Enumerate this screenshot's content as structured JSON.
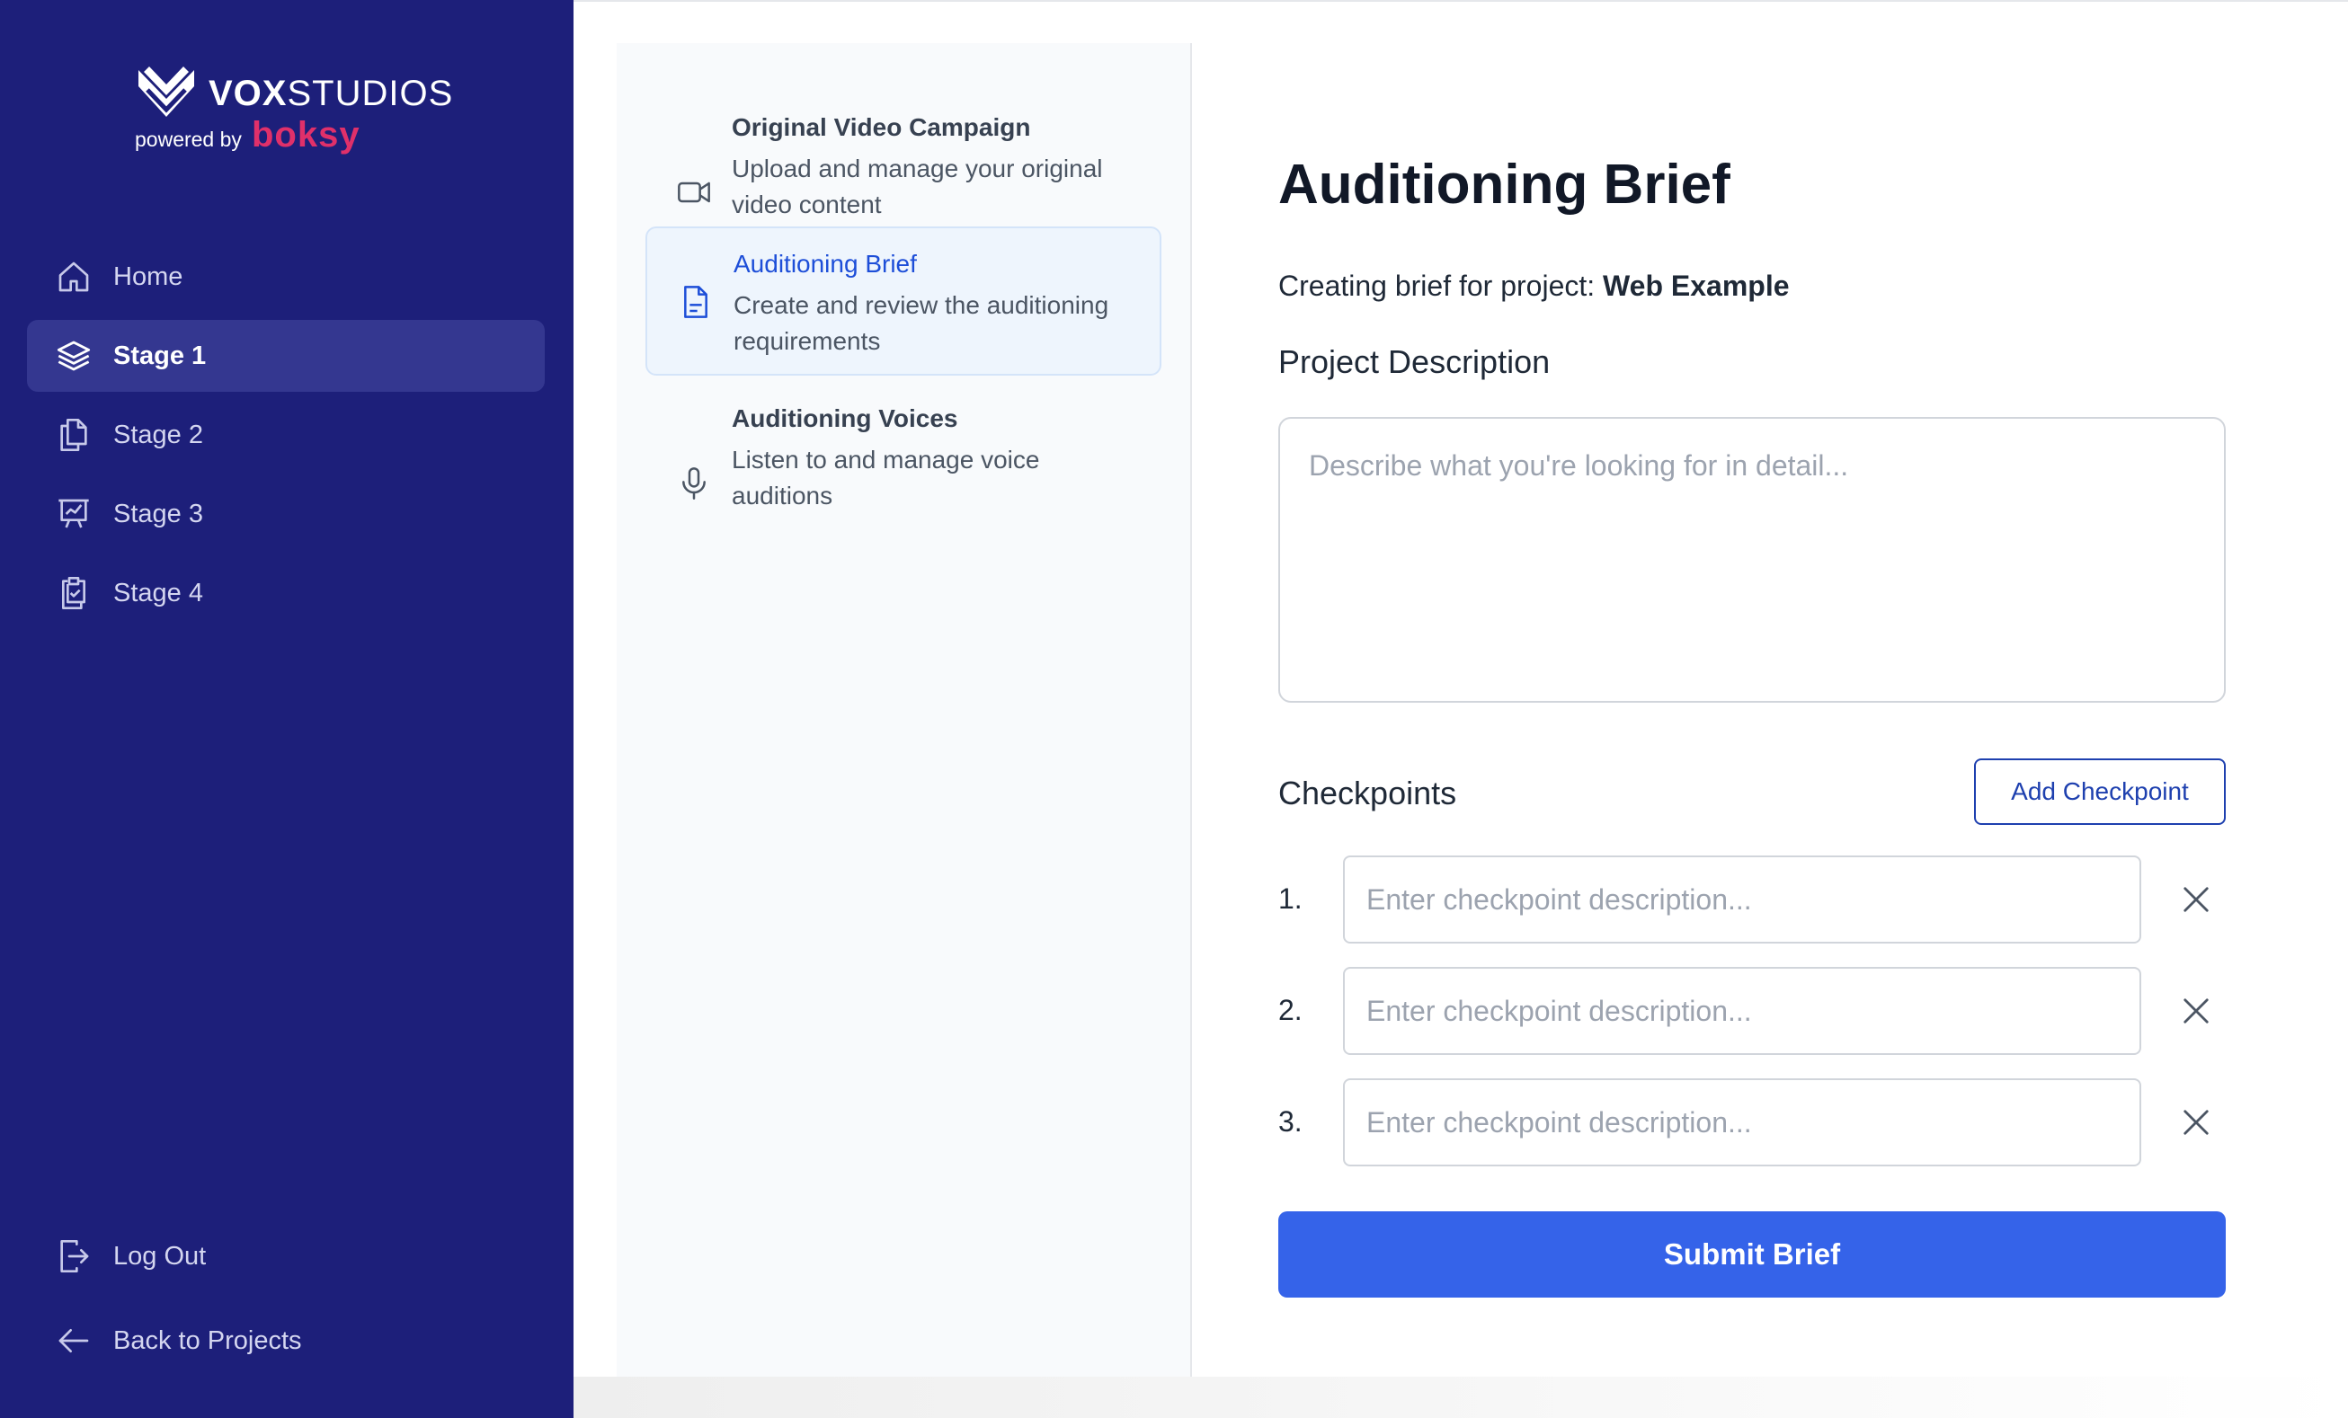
{
  "brand": {
    "name_bold": "VOX",
    "name_rest": "STUDIOS",
    "powered_by": "powered by",
    "partner": "boksy"
  },
  "sidebar": {
    "items": [
      {
        "label": "Home",
        "icon": "home-icon",
        "active": false
      },
      {
        "label": "Stage 1",
        "icon": "layers-icon",
        "active": true
      },
      {
        "label": "Stage 2",
        "icon": "files-icon",
        "active": false
      },
      {
        "label": "Stage 3",
        "icon": "presentation-chart-icon",
        "active": false
      },
      {
        "label": "Stage 4",
        "icon": "clipboard-check-icon",
        "active": false
      }
    ],
    "footer": {
      "logout_label": "Log Out",
      "back_label": "Back to Projects"
    }
  },
  "steps": [
    {
      "title": "Original Video Campaign",
      "description": "Upload and manage your original video content",
      "icon": "video-camera-icon",
      "active": false
    },
    {
      "title": "Auditioning Brief",
      "description": "Create and review the auditioning requirements",
      "icon": "document-icon",
      "active": true
    },
    {
      "title": "Auditioning Voices",
      "description": "Listen to and manage voice auditions",
      "icon": "microphone-icon",
      "active": false
    }
  ],
  "main": {
    "title": "Auditioning Brief",
    "subtitle_prefix": "Creating brief for project:",
    "project_name": "Web Example",
    "description_label": "Project Description",
    "description_placeholder": "Describe what you're looking for in detail...",
    "description_value": "",
    "checkpoints_label": "Checkpoints",
    "add_checkpoint_label": "Add Checkpoint",
    "checkpoints": [
      {
        "number": "1.",
        "placeholder": "Enter checkpoint description...",
        "value": ""
      },
      {
        "number": "2.",
        "placeholder": "Enter checkpoint description...",
        "value": ""
      },
      {
        "number": "3.",
        "placeholder": "Enter checkpoint description...",
        "value": ""
      }
    ],
    "submit_label": "Submit Brief"
  },
  "colors": {
    "sidebar_bg": "#1d1f7a",
    "sidebar_active_bg": "#343790",
    "accent_blue": "#3563e9",
    "brand_pink": "#e0306a",
    "step_active_bg": "#eef5fd"
  }
}
